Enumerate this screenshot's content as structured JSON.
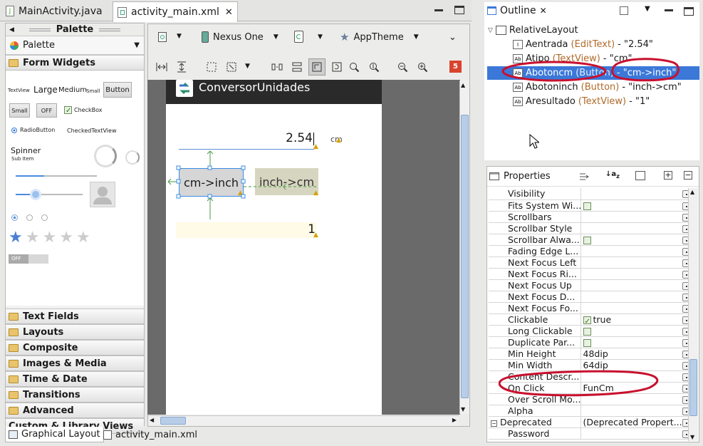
{
  "editor_tabs": [
    {
      "label": "MainActivity.java"
    },
    {
      "label": "activity_main.xml"
    }
  ],
  "palette": {
    "title": "Palette",
    "select_value": "Palette",
    "section": "Form Widgets",
    "widgets": {
      "textview": "TextView",
      "large": "Large",
      "medium": "Medium",
      "small": "Small",
      "button": "Button",
      "small_btn": "Small",
      "toggle": "OFF",
      "checkbox": "CheckBox",
      "radio": "RadioButton",
      "checked_textview": "CheckedTextView",
      "spinner": "Spinner",
      "sub_item": "Sub Item",
      "switch_off": "OFF"
    },
    "categories": [
      "Text Fields",
      "Layouts",
      "Composite",
      "Images & Media",
      "Time & Date",
      "Transitions",
      "Advanced",
      "Custom & Library Views"
    ]
  },
  "toolbar": {
    "device": "Nexus One",
    "theme": "AppTheme",
    "error_count": "5"
  },
  "preview": {
    "app_title": "ConversorUnidades",
    "edittext_value": "2.54",
    "unit_label": "cm",
    "button1_label": "cm->inch",
    "button2_label": "inch->cm",
    "result_value": "1"
  },
  "bottom_tabs": [
    {
      "label": "Graphical Layout"
    },
    {
      "label": "activity_main.xml"
    }
  ],
  "outline": {
    "title": "Outline",
    "root": "RelativeLayout",
    "items": [
      {
        "name": "Aentrada",
        "type": "(EditText)",
        "value": "- \"2.54\"",
        "icon": "edittext-icon"
      },
      {
        "name": "Atipo",
        "type": "(TextView)",
        "value": "- \"cm\"",
        "icon": "textview-icon"
      },
      {
        "name": "Abotoncm",
        "type": "(Button)",
        "value": "- \"cm->inch\"",
        "icon": "button-icon",
        "selected": true
      },
      {
        "name": "Abotoninch",
        "type": "(Button)",
        "value": "- \"inch->cm\"",
        "icon": "button-icon"
      },
      {
        "name": "Aresultado",
        "type": "(TextView)",
        "value": "- \"1\"",
        "icon": "textview-icon"
      }
    ]
  },
  "properties": {
    "title": "Properties",
    "rows": [
      {
        "name": "Visibility",
        "value": ""
      },
      {
        "name": "Fits System Wi...",
        "value": "",
        "check": "empty"
      },
      {
        "name": "Scrollbars",
        "value": ""
      },
      {
        "name": "Scrollbar Style",
        "value": ""
      },
      {
        "name": "Scrollbar Alwa...",
        "value": "",
        "check": "empty"
      },
      {
        "name": "Fading Edge L...",
        "value": ""
      },
      {
        "name": "Next Focus Left",
        "value": ""
      },
      {
        "name": "Next Focus Ri...",
        "value": ""
      },
      {
        "name": "Next Focus Up",
        "value": ""
      },
      {
        "name": "Next Focus D...",
        "value": ""
      },
      {
        "name": "Next Focus Fo...",
        "value": ""
      },
      {
        "name": "Clickable",
        "value": "true",
        "check": "on"
      },
      {
        "name": "Long Clickable",
        "value": "",
        "check": "empty"
      },
      {
        "name": "Duplicate Par...",
        "value": "",
        "check": "empty"
      },
      {
        "name": "Min Height",
        "value": "48dip"
      },
      {
        "name": "Min Width",
        "value": "64dip"
      },
      {
        "name": "Content Descr...",
        "value": ""
      },
      {
        "name": "On Click",
        "value": "FunCm"
      },
      {
        "name": "Over Scroll Mo...",
        "value": ""
      },
      {
        "name": "Alpha",
        "value": ""
      },
      {
        "name": "Deprecated",
        "value": "(Deprecated Propert...",
        "group": true
      },
      {
        "name": "Password",
        "value": ""
      }
    ]
  },
  "annotation_color": "#c8102e",
  "selection_color": "#3b78d8"
}
